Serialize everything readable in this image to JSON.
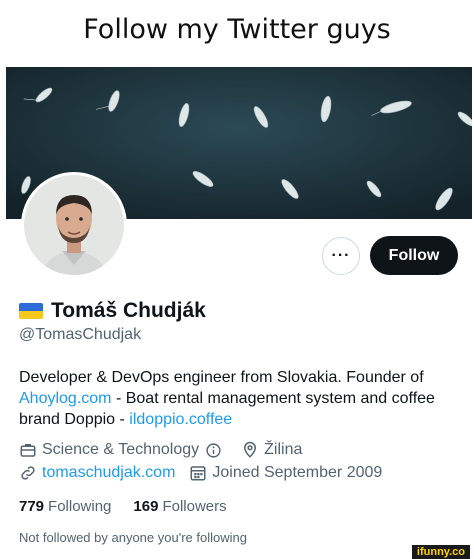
{
  "caption": "Follow my Twitter guys",
  "header": {
    "more_label": "···",
    "follow_label": "Follow"
  },
  "profile": {
    "display_name": "Tomáš Chudják",
    "handle": "@TomasChudjak",
    "bio_line1": "Developer & DevOps engineer from Slovakia. Founder of",
    "bio_link1": "Ahoylog.com",
    "bio_after_link1": " - Boat rental management system and coffee",
    "bio_line3_prefix": "brand Doppio - ",
    "bio_link2": "ildoppio.coffee"
  },
  "meta": {
    "category": "Science & Technology",
    "location": "Žilina",
    "website": "tomaschudjak.com",
    "joined": "Joined September 2009"
  },
  "stats": {
    "following_count": "779",
    "following_label": "Following",
    "followers_count": "169",
    "followers_label": "Followers"
  },
  "not_followed": "Not followed by anyone you're following",
  "watermark": "ifunny.co",
  "colors": {
    "accent": "#1d9bf0",
    "follow_bg": "#0f1419",
    "muted": "#536471",
    "banner": "#1b2f37"
  },
  "icons": {
    "more": "more-dots-icon",
    "flag": "ukraine-flag-icon",
    "category": "briefcase-icon",
    "info": "info-icon",
    "location": "location-pin-icon",
    "website": "link-icon",
    "joined": "calendar-icon"
  }
}
